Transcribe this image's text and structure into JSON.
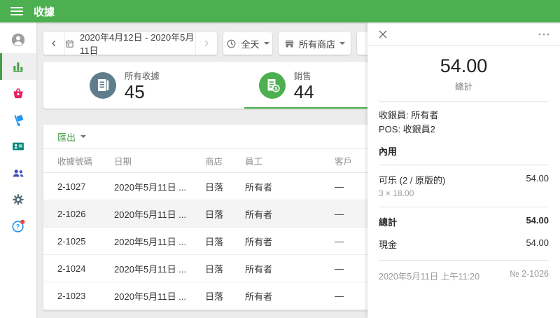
{
  "topbar": {
    "title": "收據"
  },
  "sidebar": {
    "items": [
      {
        "name": "profile",
        "color": "#9e9e9e"
      },
      {
        "name": "reports",
        "color": "#43a047",
        "selected": true
      },
      {
        "name": "items",
        "color": "#e91e63"
      },
      {
        "name": "inventory",
        "color": "#2196f3"
      },
      {
        "name": "employees",
        "color": "#00897b"
      },
      {
        "name": "customers",
        "color": "#3f51b5"
      },
      {
        "name": "settings",
        "color": "#546e7a"
      },
      {
        "name": "help",
        "color": "#2196f3",
        "badge_color": "#f44336"
      }
    ]
  },
  "filters": {
    "date_range": "2020年4月12日 - 2020年5月11日",
    "time": "全天",
    "store": "所有商店"
  },
  "summary": {
    "tabs": [
      {
        "label": "所有收據",
        "value": "45",
        "icon_color": "#607d8b"
      },
      {
        "label": "銷售",
        "value": "44",
        "icon_color": "#4caf50",
        "selected": true
      }
    ]
  },
  "table": {
    "export_label": "匯出",
    "columns": [
      "收據號碼",
      "日期",
      "商店",
      "員工",
      "客戶"
    ],
    "rows": [
      {
        "number": "2-1027",
        "date": "2020年5月11日 ...",
        "store": "日落",
        "employee": "所有者",
        "customer": "—"
      },
      {
        "number": "2-1026",
        "date": "2020年5月11日 ...",
        "store": "日落",
        "employee": "所有者",
        "customer": "—",
        "selected": true
      },
      {
        "number": "2-1025",
        "date": "2020年5月11日 ...",
        "store": "日落",
        "employee": "所有者",
        "customer": "—"
      },
      {
        "number": "2-1024",
        "date": "2020年5月11日 ...",
        "store": "日落",
        "employee": "所有者",
        "customer": "—"
      },
      {
        "number": "2-1023",
        "date": "2020年5月11日 ...",
        "store": "日落",
        "employee": "所有者",
        "customer": "—"
      }
    ]
  },
  "receipt": {
    "total": "54.00",
    "total_label": "總計",
    "cashier": "收銀員: 所有者",
    "pos": "POS: 收銀員2",
    "order_type": "內用",
    "items": [
      {
        "name": "可乐 (2 / 原版的)",
        "qty": "3 × 18.00",
        "amount": "54.00"
      }
    ],
    "totals": [
      {
        "label": "總計",
        "amount": "54.00"
      },
      {
        "label": "現金",
        "amount": "54.00"
      }
    ],
    "footer": {
      "datetime": "2020年5月11日 上午11:20",
      "number": "№ 2-1026"
    }
  },
  "colors": {
    "accent": "#4caf50",
    "background": "#ececec"
  }
}
